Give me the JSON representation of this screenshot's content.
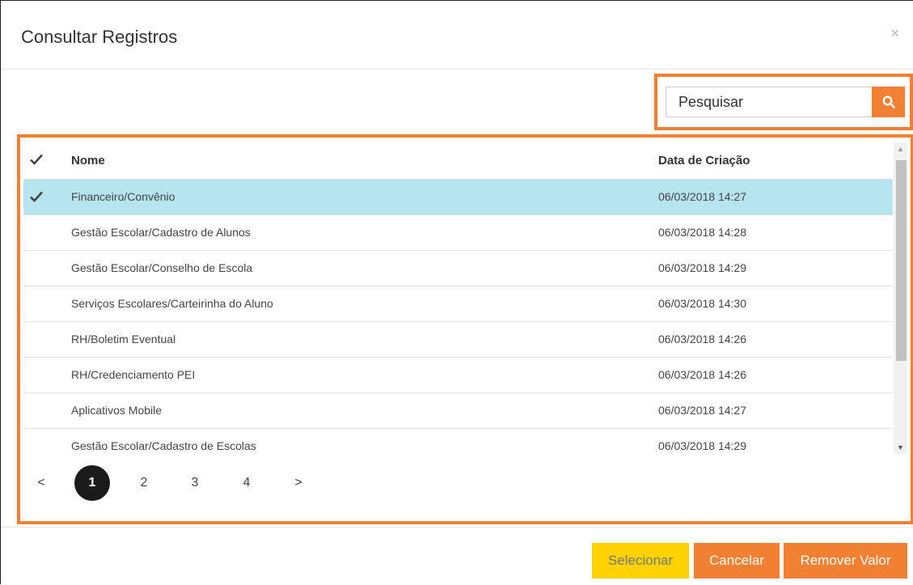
{
  "modal": {
    "title": "Consultar Registros",
    "close_label": "×"
  },
  "search": {
    "placeholder": "Pesquisar",
    "value": ""
  },
  "table": {
    "headers": {
      "check": "✔",
      "name": "Nome",
      "date": "Data de Criação"
    },
    "rows": [
      {
        "selected": true,
        "check": "✔",
        "name": "Financeiro/Convênio",
        "date": "06/03/2018 14:27"
      },
      {
        "selected": false,
        "check": "",
        "name": "Gestão Escolar/Cadastro de Alunos",
        "date": "06/03/2018 14:28"
      },
      {
        "selected": false,
        "check": "",
        "name": "Gestão Escolar/Conselho de Escola",
        "date": "06/03/2018 14:29"
      },
      {
        "selected": false,
        "check": "",
        "name": "Serviços Escolares/Carteirinha do Aluno",
        "date": "06/03/2018 14:30"
      },
      {
        "selected": false,
        "check": "",
        "name": "RH/Boletim Eventual",
        "date": "06/03/2018 14:26"
      },
      {
        "selected": false,
        "check": "",
        "name": "RH/Credenciamento PEI",
        "date": "06/03/2018 14:26"
      },
      {
        "selected": false,
        "check": "",
        "name": "Aplicativos Mobile",
        "date": "06/03/2018 14:27"
      },
      {
        "selected": false,
        "check": "",
        "name": "Gestão Escolar/Cadastro de Escolas",
        "date": "06/03/2018 14:29"
      }
    ]
  },
  "pagination": {
    "prev": "<",
    "pages": [
      "1",
      "2",
      "3",
      "4"
    ],
    "current": "1",
    "next": ">"
  },
  "footer": {
    "select_label": "Selecionar",
    "cancel_label": "Cancelar",
    "remove_label": "Remover Valor"
  },
  "colors": {
    "accent": "#f28032",
    "select_button": "#ffd200",
    "selected_row": "#b6e4ef",
    "active_page": "#1b1b1b"
  },
  "icons": {
    "search": "search-icon",
    "check": "check-icon",
    "close": "close-icon"
  }
}
